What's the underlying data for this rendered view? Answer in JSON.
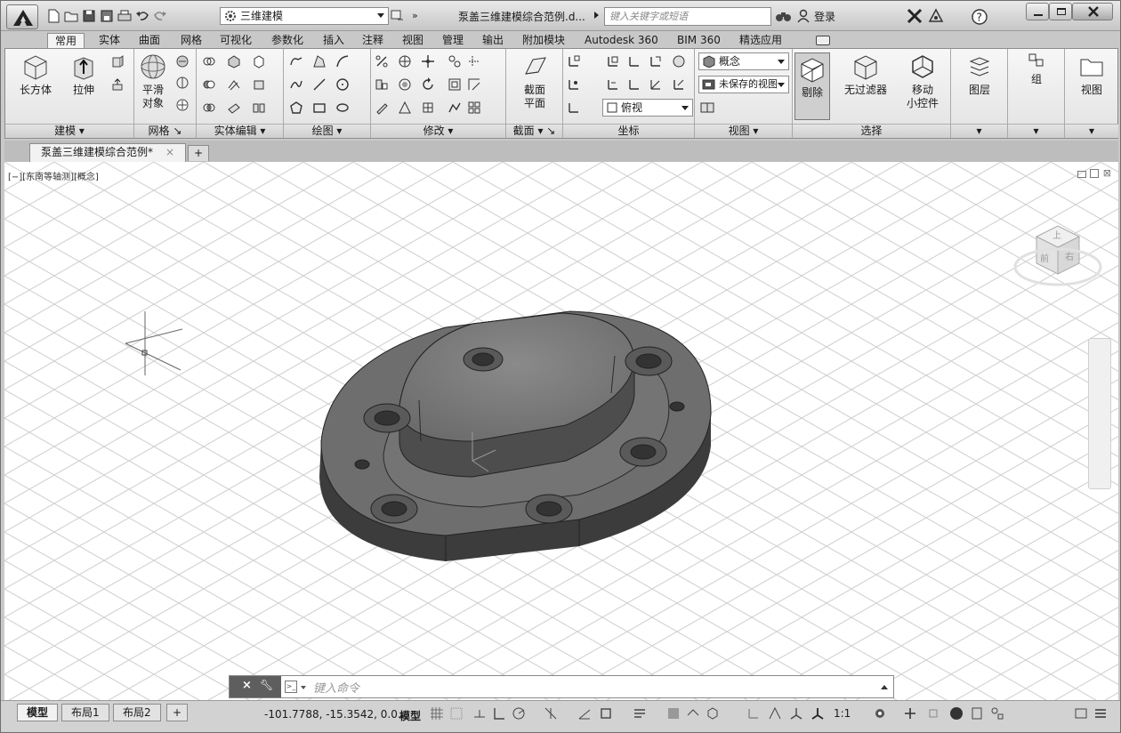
{
  "titlebar": {
    "workspace": "三维建模",
    "doc_title": "泵盖三维建模综合范例.d...",
    "search_placeholder": "键入关键字或短语",
    "login": "登录"
  },
  "tabs": [
    "常用",
    "实体",
    "曲面",
    "网格",
    "可视化",
    "参数化",
    "插入",
    "注释",
    "视图",
    "管理",
    "输出",
    "附加模块",
    "Autodesk 360",
    "BIM 360",
    "精选应用"
  ],
  "active_tab": "常用",
  "ribbon": {
    "panels": {
      "modeling": "建模",
      "mesh": "网格",
      "solid_edit": "实体编辑",
      "draw": "绘图",
      "modify": "修改",
      "section": "截面",
      "coordinates": "坐标",
      "view": "视图",
      "selection": "选择"
    },
    "buttons": {
      "box": "长方体",
      "extrude": "拉伸",
      "smooth": "平滑\n对象",
      "section_plane": "截面\n平面",
      "cull": "剔除",
      "no_filter": "无过滤器",
      "move_gizmo": "移动\n小控件",
      "layers": "图层",
      "group": "组",
      "view_btn": "视图"
    },
    "visual_style": "概念",
    "saved_view": "未保存的视图",
    "view_dir": "俯视"
  },
  "doc_tab": "泵盖三维建模综合范例*",
  "viewport": {
    "label": "[−][东南等轴测][概念]",
    "viewcube_labels": [
      "上",
      "前",
      "右"
    ]
  },
  "command": {
    "placeholder": "键入命令"
  },
  "status": {
    "layout_tabs": [
      "模型",
      "布局1",
      "布局2"
    ],
    "coords": "-101.7788, -15.3542, 0.0...",
    "model_label": "模型",
    "scale": "1:1"
  }
}
